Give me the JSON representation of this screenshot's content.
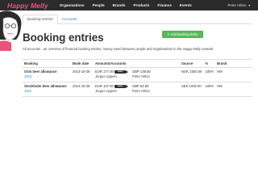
{
  "navbar": {
    "brand": "Happy Melly",
    "items": [
      "Organisations",
      "People",
      "Brands",
      "Products",
      "Finance",
      "Events"
    ],
    "user": "Peter Hilton"
  },
  "tabs": [
    {
      "label": "Booking entries"
    },
    {
      "label": "Accounts"
    }
  ],
  "page": {
    "title": "Booking entries",
    "add_button": "Add Booking Entry",
    "subtitle": "All accounts - an overview of financial booking entries, money owed between people and organisations in the Happy Melly network."
  },
  "table": {
    "headers": [
      "Booking",
      "Book date",
      "Amounts/Accounts",
      "Source",
      "%",
      "Brand"
    ],
    "rows": [
      {
        "name": "Oslo beer allowance",
        "id": "1012",
        "date": "2014-10-29",
        "from_amount": "EUR 177.00",
        "from_person": "Jurgen Appelo",
        "arrow": "owes",
        "to_amount": "GBP 139.80",
        "to_person": "Peter Hilton",
        "source": "NOK 1500.00",
        "percent": "100%",
        "brand": "HM"
      },
      {
        "name": "Stockholm beer allowance",
        "id": "1011",
        "date": "2014-10-29",
        "from_amount": "EUR 107.00",
        "from_person": "Jurgen Appelo",
        "arrow": "owes",
        "to_amount": "GBP 84.80",
        "to_person": "Peter Hilton",
        "source": "SEK 1000.00",
        "percent": "100%",
        "brand": "HM"
      }
    ]
  },
  "colors": {
    "navbar_bg": "#2b2b2b",
    "brand": "#e8547a",
    "link": "#2a88c6",
    "button": "#5cb85c"
  }
}
